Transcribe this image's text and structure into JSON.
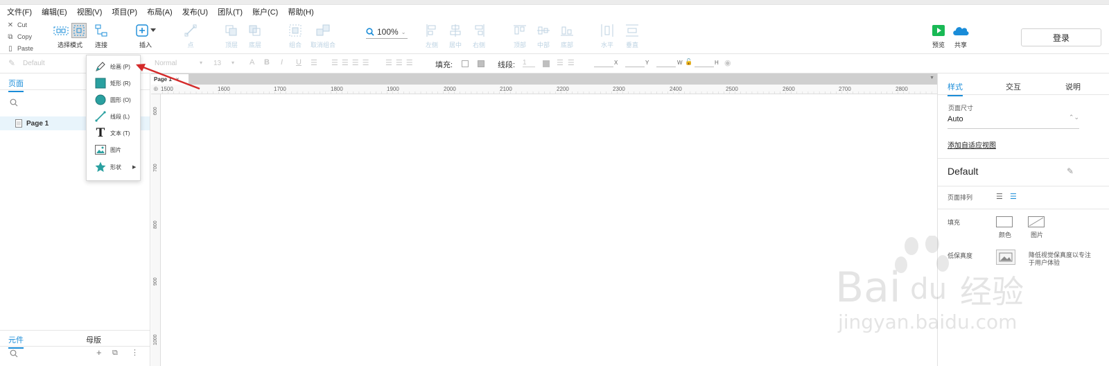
{
  "menubar": {
    "items": [
      "文件(F)",
      "编辑(E)",
      "视图(V)",
      "项目(P)",
      "布局(A)",
      "发布(U)",
      "团队(T)",
      "账户(C)",
      "帮助(H)"
    ]
  },
  "clipboard": {
    "cut": "Cut",
    "copy": "Copy",
    "paste": "Paste"
  },
  "toolbar": {
    "select_mode": "选择模式",
    "connect": "连接",
    "insert": "插入",
    "point": "点",
    "top": "顶层",
    "bottom": "底层",
    "group": "组合",
    "ungroup": "取消组合",
    "zoom": "100%",
    "align_left": "左侧",
    "align_center": "居中",
    "align_right": "右侧",
    "align_top": "顶部",
    "align_middle": "中部",
    "align_bottom": "底部",
    "horizontal": "水平",
    "vertical": "垂直",
    "preview": "预览",
    "share": "共享",
    "login": "登录"
  },
  "formatbar": {
    "style": "Default",
    "font": "Normal",
    "size": "13",
    "fill_label": "填充:",
    "line_label": "线段:",
    "line_value": "1",
    "x_label": "X",
    "y_label": "Y",
    "w_label": "W",
    "h_label": "H"
  },
  "left_panel": {
    "pages_tab": "页面",
    "page_item": "Page 1",
    "widgets_tab": "元件",
    "masters_tab": "母版"
  },
  "canvas": {
    "tab": "Page 1",
    "ruler_h": [
      "1500",
      "1600",
      "1700",
      "1800",
      "1900",
      "2000",
      "2100",
      "2200",
      "2300",
      "2400",
      "2500",
      "2600",
      "2700",
      "2800"
    ],
    "ruler_v": [
      "600",
      "700",
      "800",
      "900",
      "1000"
    ]
  },
  "dropdown": {
    "items": [
      {
        "label": "绘画 (P)",
        "icon": "pen-icon"
      },
      {
        "label": "矩形 (R)",
        "icon": "rectangle-icon"
      },
      {
        "label": "圆形 (O)",
        "icon": "circle-icon"
      },
      {
        "label": "线段 (L)",
        "icon": "line-icon"
      },
      {
        "label": "文本 (T)",
        "icon": "text-icon"
      },
      {
        "label": "图片",
        "icon": "image-icon"
      },
      {
        "label": "形状",
        "icon": "star-icon"
      }
    ]
  },
  "right_panel": {
    "tab_style": "样式",
    "tab_interaction": "交互",
    "tab_notes": "说明",
    "page_size_label": "页面尺寸",
    "page_size_value": "Auto",
    "adaptive_link": "添加自适应视图",
    "style_name": "Default",
    "page_align_label": "页面排列",
    "fill_label": "填充",
    "fill_color": "颜色",
    "fill_image": "图片",
    "low_fidelity_label": "低保真度",
    "low_fidelity_desc_1": "降低视觉保真度以专注",
    "low_fidelity_desc_2": "于用户体验"
  },
  "watermark": {
    "text_main": "Bai",
    "text_du": "du",
    "text_cn": "经验",
    "url": "jingyan.baidu.com"
  },
  "colors": {
    "accent": "#1a8cd8",
    "preview_green": "#19b955",
    "cloud_blue": "#1a8cd8",
    "arrow_red": "#d42a2a"
  }
}
